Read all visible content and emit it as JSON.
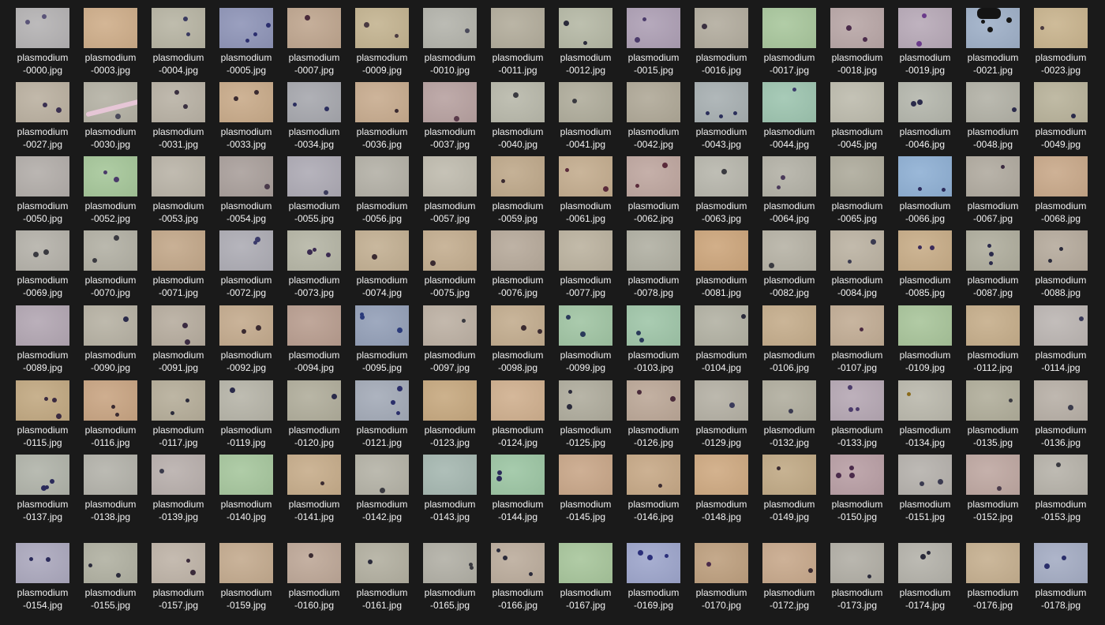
{
  "explorer": {
    "files": [
      {
        "line1": "plasmodium",
        "line2": "-0000.jpg",
        "bg": "#b5b3b4",
        "cells": 2,
        "cell": "#5a5478"
      },
      {
        "line1": "plasmodium",
        "line2": "-0003.jpg",
        "bg": "#cfae8a",
        "cells": 0,
        "cell": "#6a4a50"
      },
      {
        "line1": "plasmodium",
        "line2": "-0004.jpg",
        "bg": "#b8b5a4",
        "cells": 2,
        "cell": "#3a3a60"
      },
      {
        "line1": "plasmodium",
        "line2": "-0005.jpg",
        "bg": "#8f95b8",
        "cells": 3,
        "cell": "#2b2e6e"
      },
      {
        "line1": "plasmodium",
        "line2": "-0007.jpg",
        "bg": "#bfa68f",
        "cells": 1,
        "cell": "#4a2a3a"
      },
      {
        "line1": "plasmodium",
        "line2": "-0009.jpg",
        "bg": "#c4b491",
        "cells": 2,
        "cell": "#4a3a40"
      },
      {
        "line1": "plasmodium",
        "line2": "-0010.jpg",
        "bg": "#b4b4ac",
        "cells": 1,
        "cell": "#4a4a5a"
      },
      {
        "line1": "plasmodium",
        "line2": "-0011.jpg",
        "bg": "#b3ad9c",
        "cells": 0,
        "cell": "#4a4050"
      },
      {
        "line1": "plasmodium",
        "line2": "-0012.jpg",
        "bg": "#b6b9a6",
        "cells": 3,
        "cell": "#2a2a3a"
      },
      {
        "line1": "plasmodium",
        "line2": "-0015.jpg",
        "bg": "#aea0b5",
        "cells": 2,
        "cell": "#4a3a6a"
      },
      {
        "line1": "plasmodium",
        "line2": "-0016.jpg",
        "bg": "#b3ad9f",
        "cells": 1,
        "cell": "#3a3040"
      },
      {
        "line1": "plasmodium",
        "line2": "-0017.jpg",
        "bg": "#a9c79d",
        "cells": 0,
        "cell": "#3a4a3a"
      },
      {
        "line1": "plasmodium",
        "line2": "-0018.jpg",
        "bg": "#b9a7a7",
        "cells": 2,
        "cell": "#4a2a4a"
      },
      {
        "line1": "plasmodium",
        "line2": "-0019.jpg",
        "bg": "#b8aab8",
        "cells": 2,
        "cell": "#6a3a8a"
      },
      {
        "line1": "plasmodium",
        "line2": "-0021.jpg",
        "bg": "#9fb0c8",
        "cells": 3,
        "cell": "#151515"
      },
      {
        "line1": "plasmodium",
        "line2": "-0023.jpg",
        "bg": "#c9b48e",
        "cells": 1,
        "cell": "#4a3a40"
      },
      {
        "line1": "plasmodium",
        "line2": "-0027.jpg",
        "bg": "#bbb1a1",
        "cells": 2,
        "cell": "#3a3050"
      },
      {
        "line1": "plasmodium",
        "line2": "-0030.jpg",
        "bg": "#b5b2a5",
        "cells": 1,
        "cell": "#4a4a5a"
      },
      {
        "line1": "plasmodium",
        "line2": "-0031.jpg",
        "bg": "#b9b2a5",
        "cells": 2,
        "cell": "#3a3040"
      },
      {
        "line1": "plasmodium",
        "line2": "-0033.jpg",
        "bg": "#c9ab8a",
        "cells": 2,
        "cell": "#3a2a30"
      },
      {
        "line1": "plasmodium",
        "line2": "-0034.jpg",
        "bg": "#a7a8ae",
        "cells": 2,
        "cell": "#2b2e5e"
      },
      {
        "line1": "plasmodium",
        "line2": "-0036.jpg",
        "bg": "#c8ac8f",
        "cells": 1,
        "cell": "#3a2a30"
      },
      {
        "line1": "plasmodium",
        "line2": "-0037.jpg",
        "bg": "#b8a2a1",
        "cells": 1,
        "cell": "#5a3a4a"
      },
      {
        "line1": "plasmodium",
        "line2": "-0040.jpg",
        "bg": "#b9b9ab",
        "cells": 1,
        "cell": "#3a3a40"
      },
      {
        "line1": "plasmodium",
        "line2": "-0041.jpg",
        "bg": "#b0ad9c",
        "cells": 1,
        "cell": "#3a3a40"
      },
      {
        "line1": "plasmodium",
        "line2": "-0042.jpg",
        "bg": "#b0a998",
        "cells": 0,
        "cell": "#3a3a40"
      },
      {
        "line1": "plasmodium",
        "line2": "-0043.jpg",
        "bg": "#a8b0b2",
        "cells": 3,
        "cell": "#2a2e5a"
      },
      {
        "line1": "plasmodium",
        "line2": "-0044.jpg",
        "bg": "#9ec5b0",
        "cells": 1,
        "cell": "#3a3a6a"
      },
      {
        "line1": "plasmodium",
        "line2": "-0045.jpg",
        "bg": "#bebcae",
        "cells": 0,
        "cell": "#3a3a40"
      },
      {
        "line1": "plasmodium",
        "line2": "-0046.jpg",
        "bg": "#b5b7ad",
        "cells": 2,
        "cell": "#2a2a4a"
      },
      {
        "line1": "plasmodium",
        "line2": "-0048.jpg",
        "bg": "#b3b2a7",
        "cells": 1,
        "cell": "#2a2a4a"
      },
      {
        "line1": "plasmodium",
        "line2": "-0049.jpg",
        "bg": "#b9b39b",
        "cells": 1,
        "cell": "#2a2a4a"
      },
      {
        "line1": "plasmodium",
        "line2": "-0050.jpg",
        "bg": "#b3aeaa",
        "cells": 0,
        "cell": "#4a4050"
      },
      {
        "line1": "plasmodium",
        "line2": "-0052.jpg",
        "bg": "#a6c79a",
        "cells": 2,
        "cell": "#4a3a6a"
      },
      {
        "line1": "plasmodium",
        "line2": "-0053.jpg",
        "bg": "#bab4a8",
        "cells": 0,
        "cell": "#3a3a40"
      },
      {
        "line1": "plasmodium",
        "line2": "-0054.jpg",
        "bg": "#aaa09c",
        "cells": 1,
        "cell": "#4a3a4a"
      },
      {
        "line1": "plasmodium",
        "line2": "-0055.jpg",
        "bg": "#aeabb5",
        "cells": 1,
        "cell": "#3a3a5a"
      },
      {
        "line1": "plasmodium",
        "line2": "-0056.jpg",
        "bg": "#b4b1a7",
        "cells": 0,
        "cell": "#3a3a40"
      },
      {
        "line1": "plasmodium",
        "line2": "-0057.jpg",
        "bg": "#c0bcaf",
        "cells": 0,
        "cell": "#3a3a40"
      },
      {
        "line1": "plasmodium",
        "line2": "-0059.jpg",
        "bg": "#bfa98b",
        "cells": 1,
        "cell": "#3a2a30"
      },
      {
        "line1": "plasmodium",
        "line2": "-0061.jpg",
        "bg": "#c4ad8f",
        "cells": 2,
        "cell": "#5a2a3a"
      },
      {
        "line1": "plasmodium",
        "line2": "-0062.jpg",
        "bg": "#bfa7a0",
        "cells": 2,
        "cell": "#5a2a3a"
      },
      {
        "line1": "plasmodium",
        "line2": "-0063.jpg",
        "bg": "#b8b7ad",
        "cells": 1,
        "cell": "#3a3a40"
      },
      {
        "line1": "plasmodium",
        "line2": "-0064.jpg",
        "bg": "#b4b2a7",
        "cells": 2,
        "cell": "#4a3a5a"
      },
      {
        "line1": "plasmodium",
        "line2": "-0065.jpg",
        "bg": "#aeab9c",
        "cells": 0,
        "cell": "#3a3a40"
      },
      {
        "line1": "plasmodium",
        "line2": "-0066.jpg",
        "bg": "#8fb0d4",
        "cells": 2,
        "cell": "#2a2a5a"
      },
      {
        "line1": "plasmodium",
        "line2": "-0067.jpg",
        "bg": "#b1aba0",
        "cells": 1,
        "cell": "#3a2a40"
      },
      {
        "line1": "plasmodium",
        "line2": "-0068.jpg",
        "bg": "#c9a98a",
        "cells": 0,
        "cell": "#3a2a30"
      },
      {
        "line1": "plasmodium",
        "line2": "-0069.jpg",
        "bg": "#b5b2aa",
        "cells": 2,
        "cell": "#3a3a40"
      },
      {
        "line1": "plasmodium",
        "line2": "-0070.jpg",
        "bg": "#b3b1a5",
        "cells": 2,
        "cell": "#3a3a40"
      },
      {
        "line1": "plasmodium",
        "line2": "-0071.jpg",
        "bg": "#c3a88a",
        "cells": 0,
        "cell": "#3a2a30"
      },
      {
        "line1": "plasmodium",
        "line2": "-0072.jpg",
        "bg": "#aeadb5",
        "cells": 2,
        "cell": "#3a3a6a"
      },
      {
        "line1": "plasmodium",
        "line2": "-0073.jpg",
        "bg": "#b6b6a6",
        "cells": 3,
        "cell": "#3a2a50"
      },
      {
        "line1": "plasmodium",
        "line2": "-0074.jpg",
        "bg": "#c3b093",
        "cells": 1,
        "cell": "#3a2a30"
      },
      {
        "line1": "plasmodium",
        "line2": "-0075.jpg",
        "bg": "#c4ae90",
        "cells": 1,
        "cell": "#3a2a30"
      },
      {
        "line1": "plasmodium",
        "line2": "-0076.jpg",
        "bg": "#b7aa9b",
        "cells": 0,
        "cell": "#3a3a40"
      },
      {
        "line1": "plasmodium",
        "line2": "-0077.jpg",
        "bg": "#bcb3a0",
        "cells": 0,
        "cell": "#3a3a40"
      },
      {
        "line1": "plasmodium",
        "line2": "-0078.jpg",
        "bg": "#b1b0a3",
        "cells": 0,
        "cell": "#3a3a40"
      },
      {
        "line1": "plasmodium",
        "line2": "-0081.jpg",
        "bg": "#cda67c",
        "cells": 0,
        "cell": "#3a2a30"
      },
      {
        "line1": "plasmodium",
        "line2": "-0082.jpg",
        "bg": "#b7b3a6",
        "cells": 1,
        "cell": "#3a3a40"
      },
      {
        "line1": "plasmodium",
        "line2": "-0084.jpg",
        "bg": "#bcb3a3",
        "cells": 2,
        "cell": "#3a3a50"
      },
      {
        "line1": "plasmodium",
        "line2": "-0085.jpg",
        "bg": "#c8ad88",
        "cells": 2,
        "cell": "#3a2a5a"
      },
      {
        "line1": "plasmodium",
        "line2": "-0087.jpg",
        "bg": "#b0ae9e",
        "cells": 3,
        "cell": "#2a2a4a"
      },
      {
        "line1": "plasmodium",
        "line2": "-0088.jpg",
        "bg": "#b6ab9d",
        "cells": 2,
        "cell": "#2a2a3a"
      },
      {
        "line1": "plasmodium",
        "line2": "-0089.jpg",
        "bg": "#b3a7b3",
        "cells": 0,
        "cell": "#4a3a5a"
      },
      {
        "line1": "plasmodium",
        "line2": "-0090.jpg",
        "bg": "#b7b2a4",
        "cells": 1,
        "cell": "#2a2a4a"
      },
      {
        "line1": "plasmodium",
        "line2": "-0091.jpg",
        "bg": "#b7ad9f",
        "cells": 2,
        "cell": "#3a2a40"
      },
      {
        "line1": "plasmodium",
        "line2": "-0092.jpg",
        "bg": "#c4ab8e",
        "cells": 2,
        "cell": "#3a2a30"
      },
      {
        "line1": "plasmodium",
        "line2": "-0094.jpg",
        "bg": "#b99e90",
        "cells": 0,
        "cell": "#4a2a30"
      },
      {
        "line1": "plasmodium",
        "line2": "-0095.jpg",
        "bg": "#94a0b8",
        "cells": 3,
        "cell": "#2a3a7a"
      },
      {
        "line1": "plasmodium",
        "line2": "-0097.jpg",
        "bg": "#bdb1a4",
        "cells": 1,
        "cell": "#3a3a40"
      },
      {
        "line1": "plasmodium",
        "line2": "-0098.jpg",
        "bg": "#c3ad8f",
        "cells": 2,
        "cell": "#3a2a30"
      },
      {
        "line1": "plasmodium",
        "line2": "-0099.jpg",
        "bg": "#a1c5a4",
        "cells": 2,
        "cell": "#2a3a5a"
      },
      {
        "line1": "plasmodium",
        "line2": "-0103.jpg",
        "bg": "#a0c6a9",
        "cells": 2,
        "cell": "#2a3a5a"
      },
      {
        "line1": "plasmodium",
        "line2": "-0104.jpg",
        "bg": "#b3b2a4",
        "cells": 1,
        "cell": "#2a2a3a"
      },
      {
        "line1": "plasmodium",
        "line2": "-0106.jpg",
        "bg": "#c5ad8c",
        "cells": 0,
        "cell": "#3a2a30"
      },
      {
        "line1": "plasmodium",
        "line2": "-0107.jpg",
        "bg": "#c2ad95",
        "cells": 1,
        "cell": "#4a2a40"
      },
      {
        "line1": "plasmodium",
        "line2": "-0109.jpg",
        "bg": "#a9c59b",
        "cells": 0,
        "cell": "#3a4a3a"
      },
      {
        "line1": "plasmodium",
        "line2": "-0112.jpg",
        "bg": "#c6ae8b",
        "cells": 0,
        "cell": "#3a2a30"
      },
      {
        "line1": "plasmodium",
        "line2": "-0114.jpg",
        "bg": "#bcb6b3",
        "cells": 1,
        "cell": "#3a3a5a"
      },
      {
        "line1": "plasmodium",
        "line2": "-0115.jpg",
        "bg": "#c2a982",
        "cells": 3,
        "cell": "#3a2a40"
      },
      {
        "line1": "plasmodium",
        "line2": "-0116.jpg",
        "bg": "#c9a583",
        "cells": 2,
        "cell": "#3a2a30"
      },
      {
        "line1": "plasmodium",
        "line2": "-0117.jpg",
        "bg": "#b6ae9a",
        "cells": 2,
        "cell": "#2a2a3a"
      },
      {
        "line1": "plasmodium",
        "line2": "-0119.jpg",
        "bg": "#b7b5a9",
        "cells": 1,
        "cell": "#2a2a4a"
      },
      {
        "line1": "plasmodium",
        "line2": "-0120.jpg",
        "bg": "#b1ae9c",
        "cells": 1,
        "cell": "#2a2a4a"
      },
      {
        "line1": "plasmodium",
        "line2": "-0121.jpg",
        "bg": "#a4abb8",
        "cells": 3,
        "cell": "#2a2e6a"
      },
      {
        "line1": "plasmodium",
        "line2": "-0123.jpg",
        "bg": "#c7a980",
        "cells": 0,
        "cell": "#3a2a30"
      },
      {
        "line1": "plasmodium",
        "line2": "-0124.jpg",
        "bg": "#d0b08f",
        "cells": 0,
        "cell": "#3a2a30"
      },
      {
        "line1": "plasmodium",
        "line2": "-0125.jpg",
        "bg": "#b0ad9e",
        "cells": 2,
        "cell": "#2a2a3a"
      },
      {
        "line1": "plasmodium",
        "line2": "-0126.jpg",
        "bg": "#bca898",
        "cells": 2,
        "cell": "#4a2a3a"
      },
      {
        "line1": "plasmodium",
        "line2": "-0129.jpg",
        "bg": "#b5b1a5",
        "cells": 1,
        "cell": "#3a3a5a"
      },
      {
        "line1": "plasmodium",
        "line2": "-0132.jpg",
        "bg": "#b1ae9f",
        "cells": 1,
        "cell": "#3a3a50"
      },
      {
        "line1": "plasmodium",
        "line2": "-0133.jpg",
        "bg": "#b6a8b4",
        "cells": 3,
        "cell": "#4a3a6a"
      },
      {
        "line1": "plasmodium",
        "line2": "-0134.jpg",
        "bg": "#bbb9ad",
        "cells": 1,
        "cell": "#8a6a1a"
      },
      {
        "line1": "plasmodium",
        "line2": "-0135.jpg",
        "bg": "#b1ae9b",
        "cells": 1,
        "cell": "#3a3a40"
      },
      {
        "line1": "plasmodium",
        "line2": "-0136.jpg",
        "bg": "#b8b0a7",
        "cells": 1,
        "cell": "#3a3a4a"
      },
      {
        "line1": "plasmodium",
        "line2": "-0137.jpg",
        "bg": "#b1b4aa",
        "cells": 3,
        "cell": "#2a2a5a"
      },
      {
        "line1": "plasmodium",
        "line2": "-0138.jpg",
        "bg": "#b4b3ab",
        "cells": 0,
        "cell": "#3a3a40"
      },
      {
        "line1": "plasmodium",
        "line2": "-0139.jpg",
        "bg": "#b9b0ad",
        "cells": 1,
        "cell": "#3a3a4a"
      },
      {
        "line1": "plasmodium",
        "line2": "-0140.jpg",
        "bg": "#a7c79e",
        "cells": 0,
        "cell": "#3a4a3a"
      },
      {
        "line1": "plasmodium",
        "line2": "-0141.jpg",
        "bg": "#c7ad8b",
        "cells": 1,
        "cell": "#3a2a30"
      },
      {
        "line1": "plasmodium",
        "line2": "-0142.jpg",
        "bg": "#b5b3a7",
        "cells": 1,
        "cell": "#3a3a40"
      },
      {
        "line1": "plasmodium",
        "line2": "-0143.jpg",
        "bg": "#a6b8b1",
        "cells": 0,
        "cell": "#3a3a40"
      },
      {
        "line1": "plasmodium",
        "line2": "-0144.jpg",
        "bg": "#9dc6a4",
        "cells": 2,
        "cell": "#2a2a5a"
      },
      {
        "line1": "plasmodium",
        "line2": "-0145.jpg",
        "bg": "#c9a789",
        "cells": 0,
        "cell": "#3a2a30"
      },
      {
        "line1": "plasmodium",
        "line2": "-0146.jpg",
        "bg": "#c7a987",
        "cells": 1,
        "cell": "#3a2a30"
      },
      {
        "line1": "plasmodium",
        "line2": "-0148.jpg",
        "bg": "#cfaa82",
        "cells": 0,
        "cell": "#3a2a30"
      },
      {
        "line1": "plasmodium",
        "line2": "-0149.jpg",
        "bg": "#c1aa86",
        "cells": 1,
        "cell": "#3a2a30"
      },
      {
        "line1": "plasmodium",
        "line2": "-0150.jpg",
        "bg": "#b99fa5",
        "cells": 3,
        "cell": "#4a2a4a"
      },
      {
        "line1": "plasmodium",
        "line2": "-0151.jpg",
        "bg": "#b6b2ad",
        "cells": 2,
        "cell": "#3a3a50"
      },
      {
        "line1": "plasmodium",
        "line2": "-0152.jpg",
        "bg": "#bfa8a2",
        "cells": 1,
        "cell": "#4a3a4a"
      },
      {
        "line1": "plasmodium",
        "line2": "-0153.jpg",
        "bg": "#b7b3aa",
        "cells": 1,
        "cell": "#3a3a40"
      },
      {
        "line1": "plasmodium",
        "line2": "-0154.jpg",
        "bg": "#aca9be",
        "cells": 2,
        "cell": "#2a2a5a"
      },
      {
        "line1": "plasmodium",
        "line2": "-0155.jpg",
        "bg": "#b1b1a2",
        "cells": 2,
        "cell": "#2a2a3a"
      },
      {
        "line1": "plasmodium",
        "line2": "-0157.jpg",
        "bg": "#bfb4a8",
        "cells": 2,
        "cell": "#3a2a3a"
      },
      {
        "line1": "plasmodium",
        "line2": "-0159.jpg",
        "bg": "#c4ab8f",
        "cells": 0,
        "cell": "#3a2a30"
      },
      {
        "line1": "plasmodium",
        "line2": "-0160.jpg",
        "bg": "#bea898",
        "cells": 1,
        "cell": "#3a2a30"
      },
      {
        "line1": "plasmodium",
        "line2": "-0161.jpg",
        "bg": "#b3b0a1",
        "cells": 1,
        "cell": "#2a2a3a"
      },
      {
        "line1": "plasmodium",
        "line2": "-0165.jpg",
        "bg": "#b2b0a6",
        "cells": 2,
        "cell": "#3a3a40"
      },
      {
        "line1": "plasmodium",
        "line2": "-0166.jpg",
        "bg": "#bcad9d",
        "cells": 3,
        "cell": "#2a2a3a"
      },
      {
        "line1": "plasmodium",
        "line2": "-0167.jpg",
        "bg": "#a8c69c",
        "cells": 0,
        "cell": "#3a4a3a"
      },
      {
        "line1": "plasmodium",
        "line2": "-0169.jpg",
        "bg": "#9ea6cc",
        "cells": 3,
        "cell": "#2a2e7a"
      },
      {
        "line1": "plasmodium",
        "line2": "-0170.jpg",
        "bg": "#bea07f",
        "cells": 1,
        "cell": "#4a2a4a"
      },
      {
        "line1": "plasmodium",
        "line2": "-0172.jpg",
        "bg": "#c8a98c",
        "cells": 1,
        "cell": "#3a2a30"
      },
      {
        "line1": "plasmodium",
        "line2": "-0173.jpg",
        "bg": "#b2afa6",
        "cells": 1,
        "cell": "#2a2a3a"
      },
      {
        "line1": "plasmodium",
        "line2": "-0174.jpg",
        "bg": "#b5b3ab",
        "cells": 2,
        "cell": "#2a2a3a"
      },
      {
        "line1": "plasmodium",
        "line2": "-0176.jpg",
        "bg": "#c6b090",
        "cells": 0,
        "cell": "#3a2a30"
      },
      {
        "line1": "plasmodium",
        "line2": "-0178.jpg",
        "bg": "#a5adc4",
        "cells": 2,
        "cell": "#2a2e6a"
      }
    ]
  }
}
